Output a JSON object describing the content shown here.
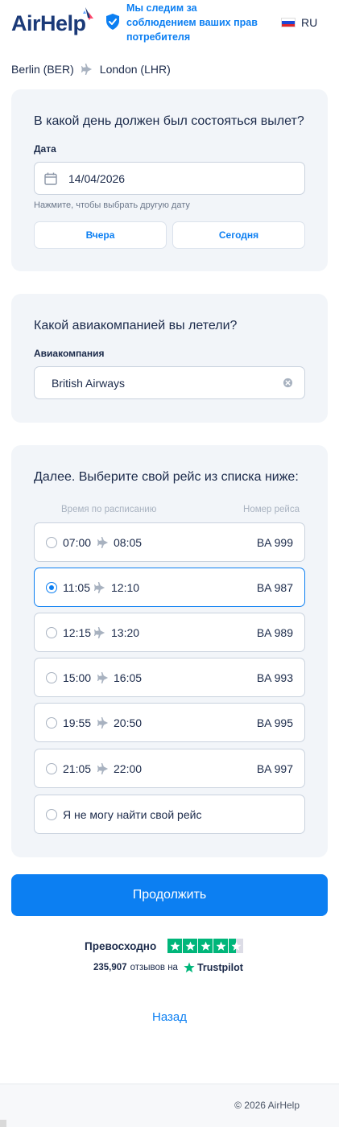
{
  "header": {
    "logo": "AirHelp",
    "tagline": "Мы следим за соблюдением ваших прав потребителя",
    "language": "RU"
  },
  "route": {
    "from": "Berlin (BER)",
    "to": "London (LHR)"
  },
  "date_card": {
    "title": "В какой день должен был состояться вылет?",
    "field_label": "Дата",
    "value": "14/04/2026",
    "hint": "Нажмите, чтобы выбрать другую дату",
    "yesterday": "Вчера",
    "today": "Сегодня"
  },
  "airline_card": {
    "title": "Какой авиакомпанией вы летели?",
    "field_label": "Авиакомпания",
    "value": "British Airways"
  },
  "flights_card": {
    "title": "Далее. Выберите свой рейс из списка ниже:",
    "col_time": "Время по расписанию",
    "col_number": "Номер рейса",
    "flights": [
      {
        "dep": "07:00",
        "arr": "08:05",
        "number": "BA 999",
        "selected": false
      },
      {
        "dep": "11:05",
        "arr": "12:10",
        "number": "BA 987",
        "selected": true
      },
      {
        "dep": "12:15",
        "arr": "13:20",
        "number": "BA 989",
        "selected": false
      },
      {
        "dep": "15:00",
        "arr": "16:05",
        "number": "BA 993",
        "selected": false
      },
      {
        "dep": "19:55",
        "arr": "20:50",
        "number": "BA 995",
        "selected": false
      },
      {
        "dep": "21:05",
        "arr": "22:00",
        "number": "BA 997",
        "selected": false
      }
    ],
    "not_found": "Я не могу найти свой рейс"
  },
  "continue_label": "Продолжить",
  "trustpilot": {
    "rating_label": "Превосходно",
    "stars": 4.5,
    "review_count": "235,907",
    "reviews_text": "отзывов на",
    "brand": "Trustpilot"
  },
  "back_label": "Назад",
  "footer": {
    "copyright": "© 2026 AirHelp"
  },
  "colors": {
    "accent": "#0c7ff2",
    "navy": "#1b3a78",
    "card": "#f2f5f9",
    "trustpilot": "#00b67a"
  }
}
